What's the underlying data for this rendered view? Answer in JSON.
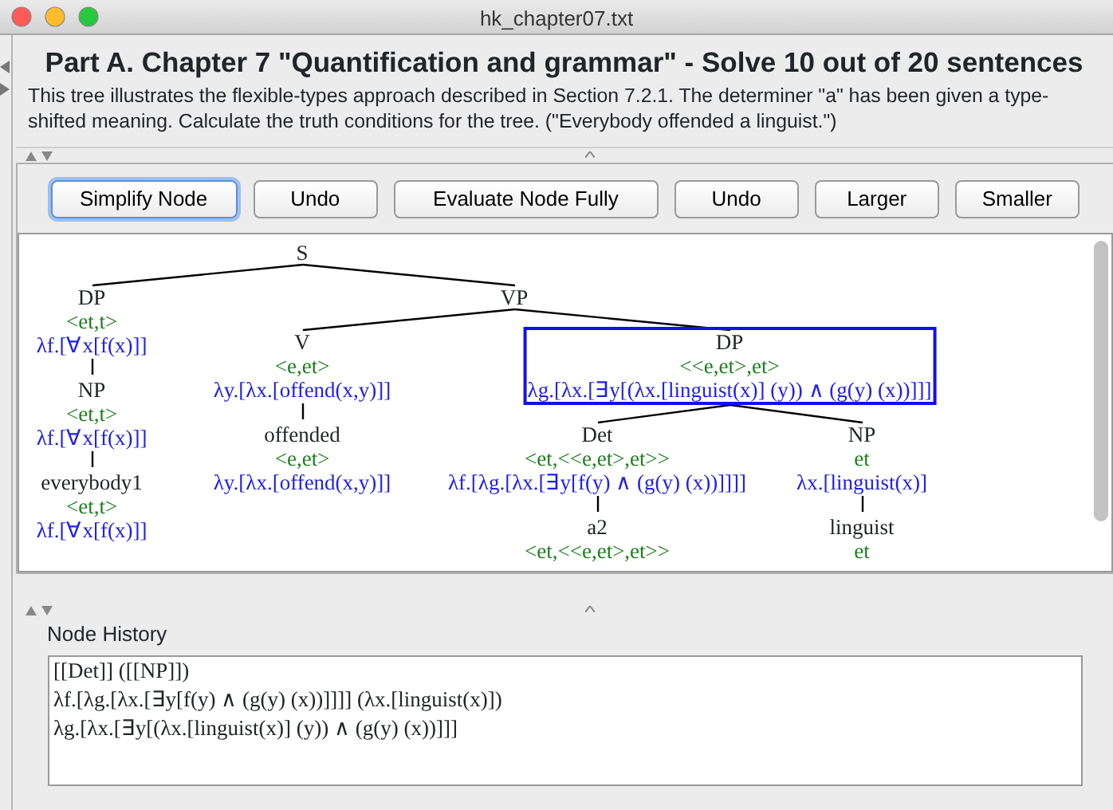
{
  "window": {
    "title": "hk_chapter07.txt"
  },
  "heading": "Part A. Chapter 7 \"Quantification and grammar\" - Solve 10 out of 20 sentences",
  "description": "This tree illustrates the flexible-types approach described in Section 7.2.1. The determiner \"a\" has been given a type-shifted meaning. Calculate the truth conditions for the tree. (\"Everybody offended a linguist.\")",
  "buttons": [
    {
      "label": "Simplify Node",
      "focused": true
    },
    {
      "label": "Undo",
      "focused": false
    },
    {
      "label": "Evaluate Node Fully",
      "focused": false
    },
    {
      "label": "Undo",
      "focused": false
    },
    {
      "label": "Larger",
      "focused": false
    },
    {
      "label": "Smaller",
      "focused": false
    }
  ],
  "tree": {
    "label": "S",
    "selected": false,
    "children": [
      {
        "label": "DP",
        "type": "<et,t>",
        "formula": "λf.[∀x[f(x)]]",
        "selected": false,
        "children": [
          {
            "label": "NP",
            "type": "<et,t>",
            "formula": "λf.[∀x[f(x)]]",
            "selected": false,
            "children": [
              {
                "label": "everybody1",
                "type": "<et,t>",
                "formula": "λf.[∀x[f(x)]]",
                "selected": false
              }
            ]
          }
        ]
      },
      {
        "label": "VP",
        "selected": false,
        "children": [
          {
            "label": "V",
            "type": "<e,et>",
            "formula": "λy.[λx.[offend(x,y)]]",
            "selected": false,
            "children": [
              {
                "label": "offended",
                "type": "<e,et>",
                "formula": "λy.[λx.[offend(x,y)]]",
                "selected": false
              }
            ]
          },
          {
            "label": "DP",
            "type": "<<e,et>,et>",
            "formula": "λg.[λx.[∃y[(λx.[linguist(x)] (y)) ∧ (g(y) (x))]]]",
            "selected": true,
            "children": [
              {
                "label": "Det",
                "type": "<et,<<e,et>,et>>",
                "formula": "λf.[λg.[λx.[∃y[f(y) ∧ (g(y) (x))]]]]",
                "selected": false,
                "children": [
                  {
                    "label": "a2",
                    "type": "<et,<<e,et>,et>>",
                    "selected": false
                  }
                ]
              },
              {
                "label": "NP",
                "type": "et",
                "formula": "λx.[linguist(x)]",
                "selected": false,
                "children": [
                  {
                    "label": "linguist",
                    "type": "et",
                    "selected": false
                  }
                ]
              }
            ]
          }
        ]
      }
    ]
  },
  "node_history": {
    "title": "Node History",
    "lines": [
      "[[Det]] ([[NP]])",
      "λf.[λg.[λx.[∃y[f(y) ∧ (g(y) (x))]]]] (λx.[linguist(x)])",
      "λg.[λx.[∃y[(λx.[linguist(x)] (y)) ∧ (g(y) (x))]]]"
    ]
  }
}
